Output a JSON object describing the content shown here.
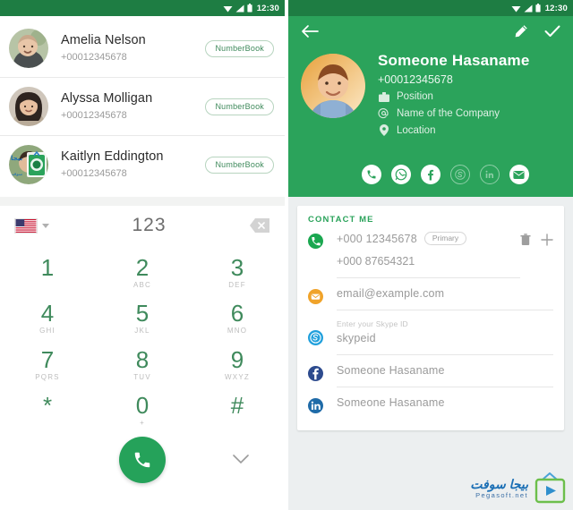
{
  "status_bar": {
    "time": "12:30",
    "icons": [
      "wifi-icon",
      "signal-icon",
      "battery-icon"
    ]
  },
  "colors": {
    "primary_green": "#2ba35b",
    "status_green": "#1e7d43",
    "accent_green": "#3f8a5c",
    "page_bg": "#eceff0",
    "muted_text": "#9a9a9a"
  },
  "left_screen": {
    "contacts": [
      {
        "name": "Amelia Nelson",
        "number": "+00012345678",
        "badge": "NumberBook",
        "avatar": "woman-avatar-1"
      },
      {
        "name": "Alyssa Molligan",
        "number": "+00012345678",
        "badge": "NumberBook",
        "avatar": "woman-avatar-2"
      },
      {
        "name": "Kaitlyn Eddington",
        "number": "+00012345678",
        "badge": "NumberBook",
        "avatar": "woman-avatar-3"
      }
    ],
    "dialer": {
      "country_flag": "us-flag-icon",
      "dropdown": "chevron-down-icon",
      "input_value": "123",
      "backspace": "backspace-icon",
      "keys": [
        {
          "digit": "1",
          "letters": ""
        },
        {
          "digit": "2",
          "letters": "ABC"
        },
        {
          "digit": "3",
          "letters": "DEF"
        },
        {
          "digit": "4",
          "letters": "GHI"
        },
        {
          "digit": "5",
          "letters": "JKL"
        },
        {
          "digit": "6",
          "letters": "MNO"
        },
        {
          "digit": "7",
          "letters": "PQRS"
        },
        {
          "digit": "8",
          "letters": "TUV"
        },
        {
          "digit": "9",
          "letters": "WXYZ"
        },
        {
          "digit": "*",
          "letters": ""
        },
        {
          "digit": "0",
          "letters": "+"
        },
        {
          "digit": "#",
          "letters": ""
        }
      ],
      "call_button": "call-icon",
      "collapse_button": "chevron-down-icon"
    }
  },
  "right_screen": {
    "header": {
      "back": "arrow-back-icon",
      "edit": "pencil-icon",
      "done": "check-icon",
      "name": "Someone Hasaname",
      "phone": "+00012345678",
      "meta": [
        {
          "icon": "briefcase-icon",
          "text": "Position"
        },
        {
          "icon": "at-icon",
          "text": "Name of the Company"
        },
        {
          "icon": "pin-icon",
          "text": "Location"
        }
      ],
      "social": [
        {
          "icon": "phone-icon",
          "style": "filled"
        },
        {
          "icon": "whatsapp-icon",
          "style": "filled"
        },
        {
          "icon": "facebook-icon",
          "style": "filled"
        },
        {
          "icon": "skype-icon",
          "style": "outline"
        },
        {
          "icon": "linkedin-icon",
          "style": "outline"
        },
        {
          "icon": "email-icon",
          "style": "filled"
        }
      ]
    },
    "card": {
      "title": "CONTACT ME",
      "delete_icon": "trash-icon",
      "add_icon": "plus-icon",
      "fields": [
        {
          "icon": "phone-icon",
          "label": "",
          "value": "+000 12345678",
          "chip": "Primary",
          "value2": "+000 87654321"
        },
        {
          "icon": "email-icon",
          "label": "",
          "value": "email@example.com",
          "chip": "",
          "value2": ""
        },
        {
          "icon": "skype-icon",
          "label": "Enter your Skype ID",
          "value": "skypeid",
          "chip": "",
          "value2": ""
        },
        {
          "icon": "facebook-icon",
          "label": "",
          "value": "Someone Hasaname",
          "chip": "",
          "value2": ""
        },
        {
          "icon": "linkedin-icon",
          "label": "",
          "value": "Someone Hasaname",
          "chip": "",
          "value2": ""
        }
      ]
    }
  },
  "watermark": {
    "arabic": "بيجا سوفت",
    "latin": "Pegasoft.net",
    "icon": "tv-play-icon"
  }
}
